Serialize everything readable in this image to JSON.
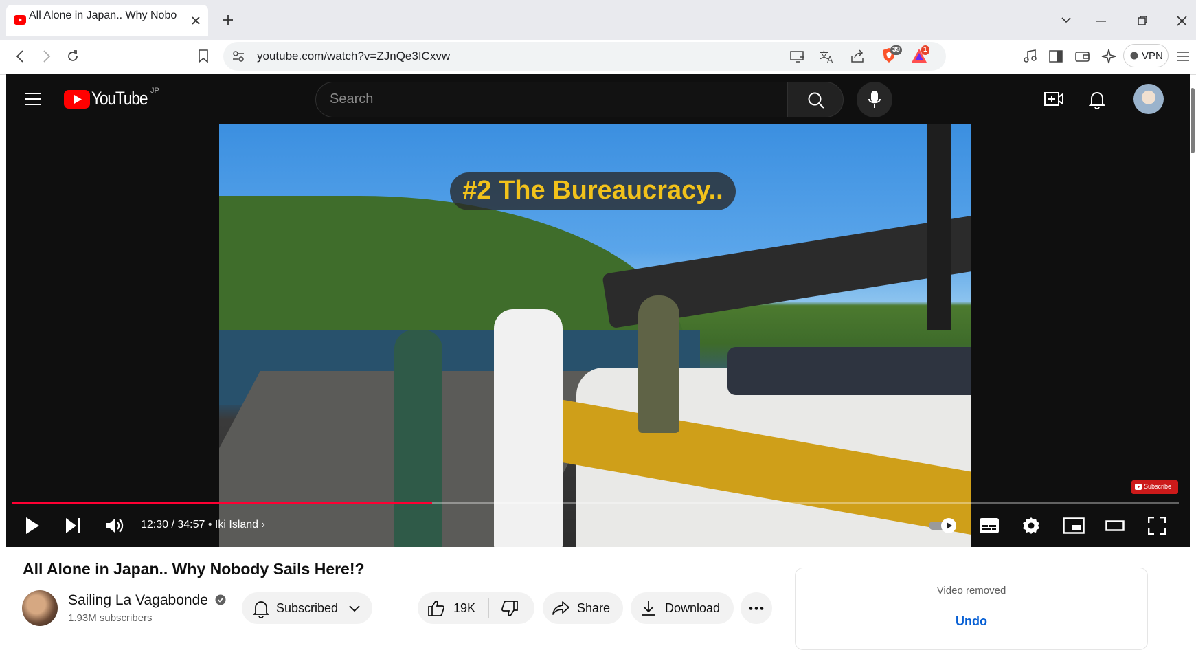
{
  "browser": {
    "tab_title": "All Alone in Japan.. Why Nobo",
    "url": "youtube.com/watch?v=ZJnQe3ICxvw",
    "brave_badge": "39",
    "alert_badge": "1",
    "vpn_label": "VPN"
  },
  "youtube": {
    "logo_text": "YouTube",
    "region": "JP",
    "search_placeholder": "Search"
  },
  "player": {
    "caption": "#2 The Bureaucracy..",
    "time": "12:30 / 34:57",
    "chapter": "Iki Island",
    "progress": 0.36,
    "watermark": "Subscribe"
  },
  "video": {
    "title": "All Alone in Japan.. Why Nobody Sails Here!?",
    "channel": "Sailing La Vagabonde",
    "subscribers": "1.93M subscribers",
    "subscribed_label": "Subscribed",
    "likes": "19K",
    "share_label": "Share",
    "download_label": "Download"
  },
  "side": {
    "removed": "Video removed",
    "undo": "Undo"
  },
  "colors": {
    "accent": "#ff0033",
    "link": "#065fd4",
    "caption": "#f2c21b"
  }
}
